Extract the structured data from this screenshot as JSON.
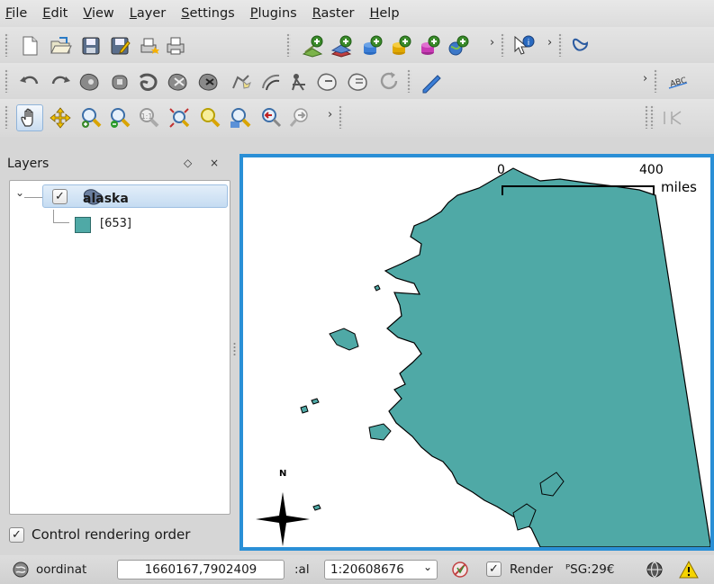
{
  "menubar": {
    "items": [
      {
        "mnemonic": "F",
        "rest": "ile"
      },
      {
        "mnemonic": "E",
        "rest": "dit"
      },
      {
        "mnemonic": "V",
        "rest": "iew"
      },
      {
        "mnemonic": "L",
        "rest": "ayer"
      },
      {
        "mnemonic": "S",
        "rest": "ettings"
      },
      {
        "mnemonic": "P",
        "rest": "lugins"
      },
      {
        "mnemonic": "R",
        "rest": "aster"
      },
      {
        "mnemonic": "H",
        "rest": "elp"
      }
    ]
  },
  "toolbars": {
    "file": [
      "new-project-icon",
      "open-project-icon",
      "save-project-icon",
      "save-as-icon",
      "print-composer-icon",
      "print-icon"
    ],
    "layers": [
      "add-vector-layer-icon",
      "add-raster-layer-icon",
      "add-postgis-layer-icon",
      "add-spatialite-layer-icon",
      "add-mssql-layer-icon",
      "add-wms-layer-icon"
    ],
    "identify": "identify-icon",
    "plugin": "plugin-icon",
    "overflow_glyph": "›"
  },
  "layers_panel": {
    "title": "Layers",
    "float_glyph": "◇",
    "close_glyph": "×",
    "expand_glyph": "⌄",
    "check_glyph": "✓",
    "layer": {
      "name": "alaska",
      "class_label": "[653]",
      "fill_color": "#4fa9a6"
    },
    "control_rendering_order": {
      "label": "Control rendering order",
      "checked": true
    }
  },
  "map": {
    "scalebar": {
      "start": "0",
      "end": "400",
      "unit": "miles"
    },
    "north_label": "N",
    "frame_color": "#2a8fd6"
  },
  "statusbar": {
    "coordinate_label": "oordinat",
    "coordinate_value": "1660167,7902409",
    "scale_label": ":al",
    "scale_value": "1:20608676",
    "render_label": "Render",
    "render_checked": true,
    "crs_label": "ᴾSG:29€",
    "dropdown_glyph": "⌄"
  }
}
